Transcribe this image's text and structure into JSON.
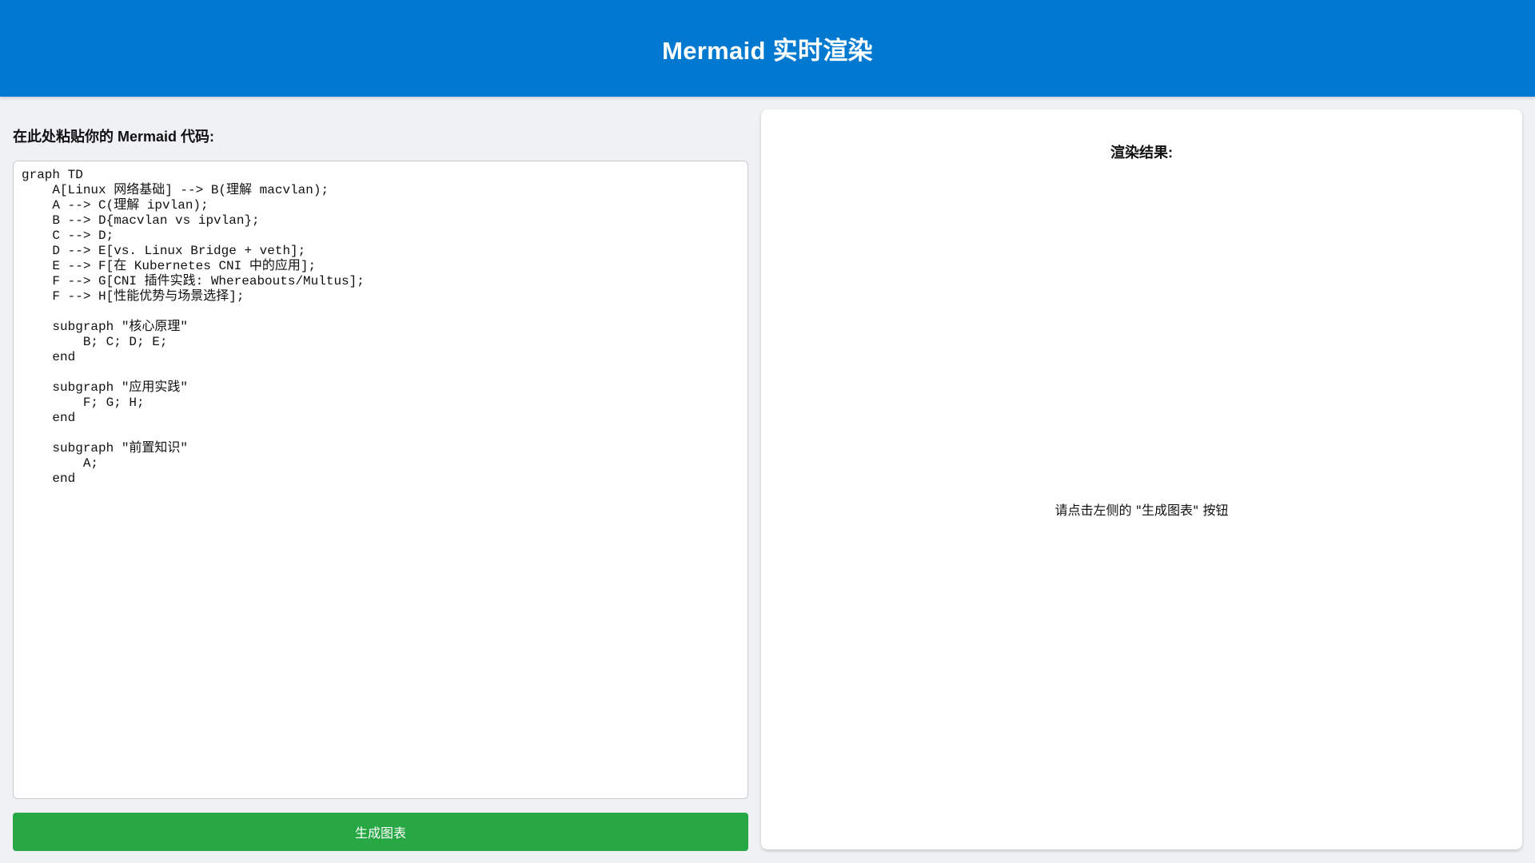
{
  "header": {
    "title": "Mermaid 实时渲染"
  },
  "editor": {
    "label": "在此处粘贴你的 Mermaid 代码:",
    "code": "graph TD\n    A[Linux 网络基础] --> B(理解 macvlan);\n    A --> C(理解 ipvlan);\n    B --> D{macvlan vs ipvlan};\n    C --> D;\n    D --> E[vs. Linux Bridge + veth];\n    E --> F[在 Kubernetes CNI 中的应用];\n    F --> G[CNI 插件实践: Whereabouts/Multus];\n    F --> H[性能优势与场景选择];\n\n    subgraph \"核心原理\"\n        B; C; D; E;\n    end\n\n    subgraph \"应用实践\"\n        F; G; H;\n    end\n\n    subgraph \"前置知识\"\n        A;\n    end"
  },
  "actions": {
    "generate_label": "生成图表"
  },
  "result": {
    "label": "渲染结果:",
    "placeholder": "请点击左侧的 \"生成图表\" 按钮"
  },
  "colors": {
    "header_bg": "#0179d0",
    "button_bg": "#27a844",
    "page_bg": "#eff1f5"
  }
}
